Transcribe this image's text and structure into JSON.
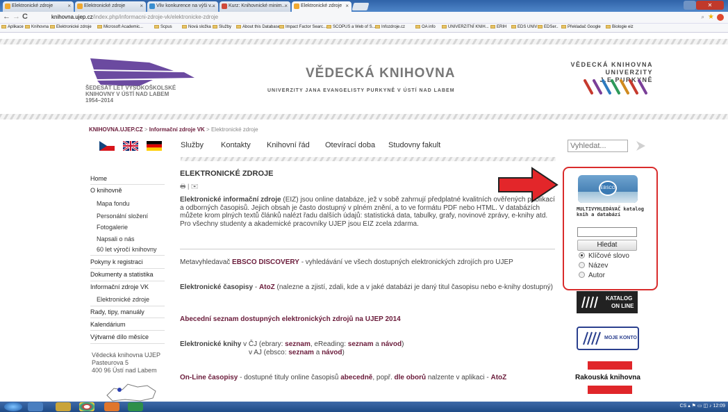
{
  "browser": {
    "tabs": [
      {
        "label": "Elektronické zdroje"
      },
      {
        "label": "Elektronické zdroje"
      },
      {
        "label": "Vliv konkurence na výši v..."
      },
      {
        "label": "Kurz: Knihovnické minim..."
      },
      {
        "label": "Elektronické zdroje"
      }
    ],
    "url_host": "knihovna.ujep.cz",
    "url_path": "/index.php/informacni-zdroje-vk/elektronicke-zdroje",
    "bookmarks": [
      "Aplikace",
      "Knihovna",
      "Elektronické zdroje",
      "Microsoft Academic...",
      "Scpus",
      "Nová složka",
      "Služby",
      "About this Database...",
      "Impact Factor Searc...",
      "SCOPUS a Web of S...",
      "Infozdroje.cz",
      "OA info",
      "UNIVERZITNÍ KNIH...",
      "ERIH",
      "EDS UNIV",
      "EDSer..",
      "Překladač Google",
      "Biologie eiz"
    ]
  },
  "header": {
    "logo_left_lines": [
      "ŠEDESÁT LET VYSOKOŠKOLSKÉ",
      "KNIHOVNY V ÚSTÍ NAD LABEM",
      "1954–2014"
    ],
    "title": "VĚDECKÁ KNIHOVNA",
    "subtitle": "UNIVERZITY JANA EVANGELISTY PURKYNĚ V ÚSTÍ NAD LABEM",
    "logo_right_lines": [
      "VĚDECKÁ KNIHOVNA",
      "UNIVERZITY J.E.PURKYNĚ"
    ]
  },
  "breadcrumb": {
    "home": "KNIHOVNA.UJEP.CZ",
    "sep": ">",
    "section": "Informační zdroje VK",
    "current": "Elektronické zdroje"
  },
  "nav": {
    "items": [
      "Služby",
      "Kontakty",
      "Knihovní řád",
      "Otevírací doba",
      "Studovny fakult"
    ],
    "search_placeholder": "Vyhledat..."
  },
  "sidebar": {
    "items": [
      {
        "label": "Home"
      },
      {
        "label": "O knihovně"
      },
      {
        "label": "Mapa fondu"
      },
      {
        "label": "Personální složení"
      },
      {
        "label": "Fotogalerie"
      },
      {
        "label": "Napsali o nás"
      },
      {
        "label": "60 let výročí knihovny"
      },
      {
        "label": "Pokyny k registraci"
      },
      {
        "label": "Dokumenty a statistika"
      },
      {
        "label": "Informační zdroje VK"
      },
      {
        "label": "Elektronické zdroje"
      },
      {
        "label": "Rady, tipy, manuály"
      },
      {
        "label": "Kalendárium"
      },
      {
        "label": "Výtvarné dílo měsíce"
      }
    ],
    "address": [
      "Vědecká knihovna UJEP",
      "Pasteurova 5",
      "400 96 Ústí nad Labem"
    ]
  },
  "content": {
    "heading": "ELEKTRONICKÉ ZDROJE",
    "intro_bold": "Elektronické informační zdroje",
    "intro_rest": " (EIZ) jsou online databáze, jež v sobě zahrnují předplatné kvalitních ověřených publikací a odborných časopisů. Jejich obsah je často dostupný v plném znění, a to ve formátu PDF nebo HTML. V databázích můžete krom plných textů článků nalézt řadu dalších údajů: statistická data, tabulky, grafy, novinové zprávy, e-knihy atd. Pro všechny studenty a akademické pracovníky UJEP jsou EIZ zcela zdarma.",
    "meta_prefix": "Metavyhledavač ",
    "meta_link": "EBSCO DISCOVERY",
    "meta_rest": " - vyhledávání ve všech dostupných elektronických zdrojích pro UJEP",
    "ejournals_label": "Elektronické časopisy",
    "ejournals_dash": " - ",
    "ejournals_link": "AtoZ",
    "ejournals_rest": " (nalezne a zjistí, zdali, kde a v jaké databázi je daný titul časopisu nebo e-knihy dostupný)",
    "alpha_list": "Abecední seznam dostupných elektronických zdrojů na UJEP 2014",
    "ebooks_label": "Elektronické knihy",
    "ebooks_cz_a": " v ČJ (ebrary: ",
    "ebooks_link1": "seznam",
    "ebooks_cz_b": ", eReading: ",
    "ebooks_link2": "seznam",
    "ebooks_cz_c": " a ",
    "ebooks_link3": "návod",
    "ebooks_cz_d": ")",
    "ebooks_aj_a": "v AJ (ebsco: ",
    "ebooks_link4": "seznam",
    "ebooks_aj_b": " a ",
    "ebooks_link5": "návod",
    "ebooks_aj_c": ")",
    "online_label": "On-Line časopisy",
    "online_a": " - dostupné tituly online časopisů ",
    "online_link1": "abecedně",
    "online_b": ", popř. ",
    "online_link2": "dle oborů",
    "online_c": " nalzente v aplikaci - ",
    "online_link3": "AtoZ"
  },
  "ebsco_widget": {
    "logo_text": "EBSCO",
    "title": "MULTIVYHLEDÁVAČ katalog knih a databází",
    "button": "Hledat",
    "options": [
      "Klíčové slovo",
      "Název",
      "Autor"
    ],
    "selected": "Klíčové slovo"
  },
  "right_banners": {
    "katalog_1": "KATALOG",
    "katalog_2": "ON LINE",
    "konto": "MOJE KONTO",
    "rakouska": "Rakouská knihovna"
  },
  "taskbar": {
    "tray_lang": "CS",
    "time": "12:09"
  },
  "colors": {
    "link": "#6a1b3a",
    "highlight_box": "#d92b2b",
    "arrow": "#e3262a"
  }
}
